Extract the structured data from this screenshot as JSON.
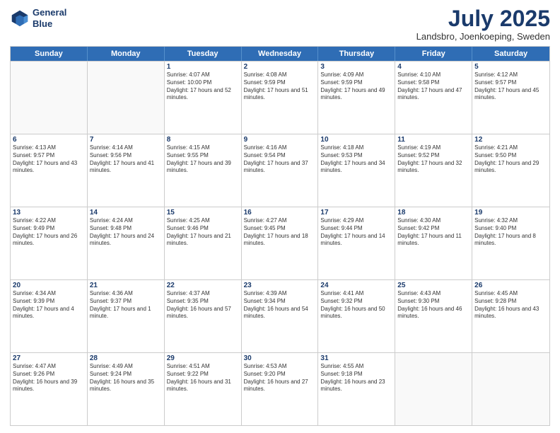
{
  "header": {
    "logo_line1": "General",
    "logo_line2": "Blue",
    "month": "July 2025",
    "location": "Landsbro, Joenkoeping, Sweden"
  },
  "days_of_week": [
    "Sunday",
    "Monday",
    "Tuesday",
    "Wednesday",
    "Thursday",
    "Friday",
    "Saturday"
  ],
  "rows": [
    [
      {
        "day": "",
        "empty": true
      },
      {
        "day": "",
        "empty": true
      },
      {
        "day": "1",
        "sunrise": "4:07 AM",
        "sunset": "10:00 PM",
        "daylight": "17 hours and 52 minutes."
      },
      {
        "day": "2",
        "sunrise": "4:08 AM",
        "sunset": "9:59 PM",
        "daylight": "17 hours and 51 minutes."
      },
      {
        "day": "3",
        "sunrise": "4:09 AM",
        "sunset": "9:59 PM",
        "daylight": "17 hours and 49 minutes."
      },
      {
        "day": "4",
        "sunrise": "4:10 AM",
        "sunset": "9:58 PM",
        "daylight": "17 hours and 47 minutes."
      },
      {
        "day": "5",
        "sunrise": "4:12 AM",
        "sunset": "9:57 PM",
        "daylight": "17 hours and 45 minutes."
      }
    ],
    [
      {
        "day": "6",
        "sunrise": "4:13 AM",
        "sunset": "9:57 PM",
        "daylight": "17 hours and 43 minutes."
      },
      {
        "day": "7",
        "sunrise": "4:14 AM",
        "sunset": "9:56 PM",
        "daylight": "17 hours and 41 minutes."
      },
      {
        "day": "8",
        "sunrise": "4:15 AM",
        "sunset": "9:55 PM",
        "daylight": "17 hours and 39 minutes."
      },
      {
        "day": "9",
        "sunrise": "4:16 AM",
        "sunset": "9:54 PM",
        "daylight": "17 hours and 37 minutes."
      },
      {
        "day": "10",
        "sunrise": "4:18 AM",
        "sunset": "9:53 PM",
        "daylight": "17 hours and 34 minutes."
      },
      {
        "day": "11",
        "sunrise": "4:19 AM",
        "sunset": "9:52 PM",
        "daylight": "17 hours and 32 minutes."
      },
      {
        "day": "12",
        "sunrise": "4:21 AM",
        "sunset": "9:50 PM",
        "daylight": "17 hours and 29 minutes."
      }
    ],
    [
      {
        "day": "13",
        "sunrise": "4:22 AM",
        "sunset": "9:49 PM",
        "daylight": "17 hours and 26 minutes."
      },
      {
        "day": "14",
        "sunrise": "4:24 AM",
        "sunset": "9:48 PM",
        "daylight": "17 hours and 24 minutes."
      },
      {
        "day": "15",
        "sunrise": "4:25 AM",
        "sunset": "9:46 PM",
        "daylight": "17 hours and 21 minutes."
      },
      {
        "day": "16",
        "sunrise": "4:27 AM",
        "sunset": "9:45 PM",
        "daylight": "17 hours and 18 minutes."
      },
      {
        "day": "17",
        "sunrise": "4:29 AM",
        "sunset": "9:44 PM",
        "daylight": "17 hours and 14 minutes."
      },
      {
        "day": "18",
        "sunrise": "4:30 AM",
        "sunset": "9:42 PM",
        "daylight": "17 hours and 11 minutes."
      },
      {
        "day": "19",
        "sunrise": "4:32 AM",
        "sunset": "9:40 PM",
        "daylight": "17 hours and 8 minutes."
      }
    ],
    [
      {
        "day": "20",
        "sunrise": "4:34 AM",
        "sunset": "9:39 PM",
        "daylight": "17 hours and 4 minutes."
      },
      {
        "day": "21",
        "sunrise": "4:36 AM",
        "sunset": "9:37 PM",
        "daylight": "17 hours and 1 minute."
      },
      {
        "day": "22",
        "sunrise": "4:37 AM",
        "sunset": "9:35 PM",
        "daylight": "16 hours and 57 minutes."
      },
      {
        "day": "23",
        "sunrise": "4:39 AM",
        "sunset": "9:34 PM",
        "daylight": "16 hours and 54 minutes."
      },
      {
        "day": "24",
        "sunrise": "4:41 AM",
        "sunset": "9:32 PM",
        "daylight": "16 hours and 50 minutes."
      },
      {
        "day": "25",
        "sunrise": "4:43 AM",
        "sunset": "9:30 PM",
        "daylight": "16 hours and 46 minutes."
      },
      {
        "day": "26",
        "sunrise": "4:45 AM",
        "sunset": "9:28 PM",
        "daylight": "16 hours and 43 minutes."
      }
    ],
    [
      {
        "day": "27",
        "sunrise": "4:47 AM",
        "sunset": "9:26 PM",
        "daylight": "16 hours and 39 minutes."
      },
      {
        "day": "28",
        "sunrise": "4:49 AM",
        "sunset": "9:24 PM",
        "daylight": "16 hours and 35 minutes."
      },
      {
        "day": "29",
        "sunrise": "4:51 AM",
        "sunset": "9:22 PM",
        "daylight": "16 hours and 31 minutes."
      },
      {
        "day": "30",
        "sunrise": "4:53 AM",
        "sunset": "9:20 PM",
        "daylight": "16 hours and 27 minutes."
      },
      {
        "day": "31",
        "sunrise": "4:55 AM",
        "sunset": "9:18 PM",
        "daylight": "16 hours and 23 minutes."
      },
      {
        "day": "",
        "empty": true
      },
      {
        "day": "",
        "empty": true
      }
    ]
  ]
}
